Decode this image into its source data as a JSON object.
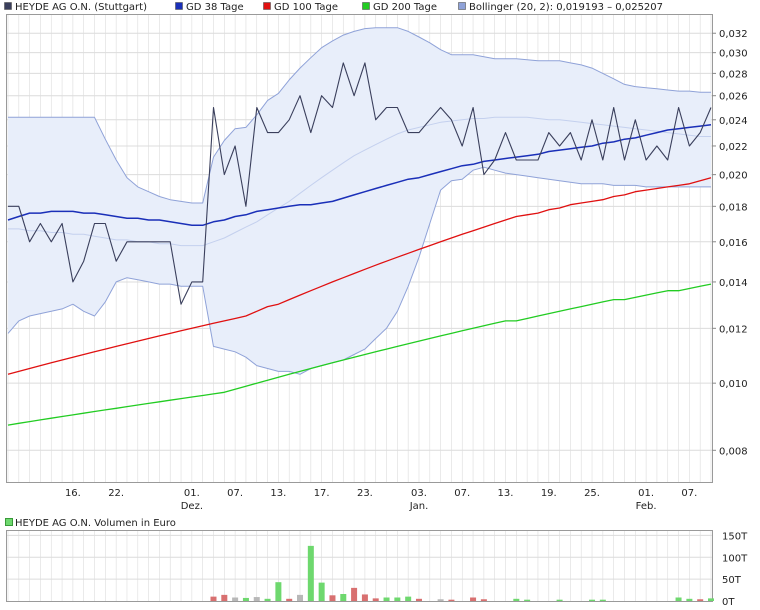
{
  "colors": {
    "price": "#3a3f5c",
    "gd38": "#1a2fb8",
    "gd100": "#e01010",
    "gd200": "#22cc22",
    "bollinger_fill": "#e8eefa",
    "bollinger_line": "#8fa2d8",
    "bollinger_mid": "#c4d0ee",
    "volume_up": "#6ed86e",
    "volume_down": "#d87070",
    "volume_flat": "#b8b8b8",
    "grid": "#dcdcdc"
  },
  "chart_data": [
    {
      "type": "line",
      "scale": "log",
      "legend": [
        {
          "label": "HEYDE AG O.N. (Stuttgart)",
          "color": "#3a3f5c"
        },
        {
          "label": "GD 38 Tage",
          "color": "#1a2fb8"
        },
        {
          "label": "GD 100 Tage",
          "color": "#e01010"
        },
        {
          "label": "GD 200 Tage",
          "color": "#22cc22"
        },
        {
          "label": "Bollinger (20, 2): 0,019193 – 0,025207",
          "color": "#8fa2d8"
        }
      ],
      "legend_placement": "top",
      "ylim": [
        0.0072,
        0.034
      ],
      "y_ticks": [
        {
          "value": 0.008,
          "label": "0,008"
        },
        {
          "value": 0.01,
          "label": "0,010"
        },
        {
          "value": 0.012,
          "label": "0,012"
        },
        {
          "value": 0.014,
          "label": "0,014"
        },
        {
          "value": 0.016,
          "label": "0,016"
        },
        {
          "value": 0.018,
          "label": "0,018"
        },
        {
          "value": 0.02,
          "label": "0,020"
        },
        {
          "value": 0.022,
          "label": "0,022"
        },
        {
          "value": 0.024,
          "label": "0,024"
        },
        {
          "value": 0.026,
          "label": "0,026"
        },
        {
          "value": 0.028,
          "label": "0,028"
        },
        {
          "value": 0.03,
          "label": "0,030"
        },
        {
          "value": 0.032,
          "label": "0,032"
        }
      ],
      "x_ticks": [
        {
          "i": 6,
          "label": "16.",
          "sub": ""
        },
        {
          "i": 10,
          "label": "22.",
          "sub": ""
        },
        {
          "i": 17,
          "label": "01.",
          "sub": "Dez."
        },
        {
          "i": 21,
          "label": "07.",
          "sub": ""
        },
        {
          "i": 25,
          "label": "13.",
          "sub": ""
        },
        {
          "i": 29,
          "label": "17.",
          "sub": ""
        },
        {
          "i": 33,
          "label": "23.",
          "sub": ""
        },
        {
          "i": 38,
          "label": "03.",
          "sub": "Jan."
        },
        {
          "i": 42,
          "label": "07.",
          "sub": ""
        },
        {
          "i": 46,
          "label": "13.",
          "sub": ""
        },
        {
          "i": 50,
          "label": "19.",
          "sub": ""
        },
        {
          "i": 54,
          "label": "25.",
          "sub": ""
        },
        {
          "i": 59,
          "label": "01.",
          "sub": "Feb."
        },
        {
          "i": 63,
          "label": "07.",
          "sub": ""
        }
      ],
      "n_points": 66,
      "grid": true,
      "series": [
        {
          "name": "HEYDE AG O.N. (Stuttgart)",
          "key": "price",
          "values": [
            0.018,
            0.018,
            0.016,
            0.017,
            0.016,
            0.017,
            0.014,
            0.015,
            0.017,
            0.017,
            0.015,
            0.016,
            0.016,
            0.016,
            0.016,
            0.016,
            0.013,
            0.014,
            0.014,
            0.025,
            0.02,
            0.022,
            0.018,
            0.025,
            0.023,
            0.023,
            0.024,
            0.026,
            0.023,
            0.026,
            0.025,
            0.029,
            0.026,
            0.029,
            0.024,
            0.025,
            0.025,
            0.023,
            0.023,
            0.024,
            0.025,
            0.024,
            0.022,
            0.025,
            0.02,
            0.021,
            0.023,
            0.021,
            0.021,
            0.021,
            0.023,
            0.022,
            0.023,
            0.021,
            0.024,
            0.021,
            0.025,
            0.021,
            0.024,
            0.021,
            0.022,
            0.021,
            0.025,
            0.022,
            0.023,
            0.025
          ]
        },
        {
          "name": "GD 38 Tage",
          "key": "gd38",
          "values": [
            0.0172,
            0.0174,
            0.0176,
            0.0176,
            0.0177,
            0.0177,
            0.0177,
            0.0176,
            0.0176,
            0.0175,
            0.0174,
            0.0173,
            0.0173,
            0.0172,
            0.0172,
            0.0171,
            0.017,
            0.0169,
            0.0169,
            0.0171,
            0.0172,
            0.0174,
            0.0175,
            0.0177,
            0.0178,
            0.0179,
            0.018,
            0.0181,
            0.0181,
            0.0182,
            0.0183,
            0.0185,
            0.0187,
            0.0189,
            0.0191,
            0.0193,
            0.0195,
            0.0197,
            0.0198,
            0.02,
            0.0202,
            0.0204,
            0.0206,
            0.0207,
            0.0209,
            0.021,
            0.0211,
            0.0212,
            0.0213,
            0.0214,
            0.0216,
            0.0217,
            0.0218,
            0.0219,
            0.022,
            0.0222,
            0.0223,
            0.0225,
            0.0226,
            0.0228,
            0.023,
            0.0232,
            0.0233,
            0.0234,
            0.0235,
            0.0236
          ]
        },
        {
          "name": "GD 100 Tage",
          "key": "gd100",
          "values": [
            0.0103,
            0.0104,
            0.0105,
            0.0106,
            0.0107,
            0.0108,
            0.0109,
            0.011,
            0.0111,
            0.0112,
            0.0113,
            0.0114,
            0.0115,
            0.0116,
            0.0117,
            0.0118,
            0.0119,
            0.012,
            0.0121,
            0.0122,
            0.0123,
            0.0124,
            0.0125,
            0.0127,
            0.0129,
            0.013,
            0.0132,
            0.0134,
            0.0136,
            0.0138,
            0.014,
            0.0142,
            0.0144,
            0.0146,
            0.0148,
            0.015,
            0.0152,
            0.0154,
            0.0156,
            0.0158,
            0.016,
            0.0162,
            0.0164,
            0.0166,
            0.0168,
            0.017,
            0.0172,
            0.0174,
            0.0175,
            0.0176,
            0.0178,
            0.0179,
            0.0181,
            0.0182,
            0.0183,
            0.0184,
            0.0186,
            0.0187,
            0.0189,
            0.019,
            0.0191,
            0.0192,
            0.0193,
            0.0194,
            0.0196,
            0.0198
          ]
        },
        {
          "name": "GD 200 Tage",
          "key": "gd200",
          "values": [
            0.0087,
            0.00875,
            0.0088,
            0.00885,
            0.0089,
            0.00895,
            0.009,
            0.00905,
            0.0091,
            0.00915,
            0.0092,
            0.00925,
            0.0093,
            0.00935,
            0.0094,
            0.00945,
            0.0095,
            0.00955,
            0.0096,
            0.00965,
            0.0097,
            0.0098,
            0.0099,
            0.01,
            0.0101,
            0.0102,
            0.0103,
            0.0104,
            0.0105,
            0.0106,
            0.0107,
            0.0108,
            0.0109,
            0.011,
            0.0111,
            0.0112,
            0.0113,
            0.0114,
            0.0115,
            0.0116,
            0.0117,
            0.0118,
            0.0119,
            0.012,
            0.0121,
            0.0122,
            0.0123,
            0.0123,
            0.0124,
            0.0125,
            0.0126,
            0.0127,
            0.0128,
            0.0129,
            0.013,
            0.0131,
            0.0132,
            0.0132,
            0.0133,
            0.0134,
            0.0135,
            0.0136,
            0.0136,
            0.0137,
            0.0138,
            0.0139
          ]
        },
        {
          "name": "Bollinger upper",
          "key": "boll_upper",
          "values": [
            0.0242,
            0.0242,
            0.0242,
            0.0242,
            0.0242,
            0.0242,
            0.0242,
            0.0242,
            0.0242,
            0.0225,
            0.021,
            0.0198,
            0.0192,
            0.0189,
            0.0186,
            0.0184,
            0.0183,
            0.0182,
            0.0182,
            0.0212,
            0.0224,
            0.0233,
            0.0234,
            0.0244,
            0.0256,
            0.0262,
            0.0274,
            0.0285,
            0.0295,
            0.0305,
            0.0312,
            0.0318,
            0.0322,
            0.0325,
            0.0326,
            0.0326,
            0.0326,
            0.0322,
            0.0316,
            0.031,
            0.0303,
            0.0298,
            0.0298,
            0.0298,
            0.0296,
            0.0294,
            0.0294,
            0.0294,
            0.0293,
            0.0292,
            0.0292,
            0.0292,
            0.029,
            0.0288,
            0.0285,
            0.028,
            0.0275,
            0.027,
            0.0268,
            0.0267,
            0.0266,
            0.0265,
            0.0264,
            0.0264,
            0.0263,
            0.0263
          ]
        },
        {
          "name": "Bollinger middle",
          "key": "boll_mid",
          "values": [
            0.0167,
            0.0167,
            0.0166,
            0.0166,
            0.0165,
            0.0165,
            0.0164,
            0.0164,
            0.0163,
            0.0162,
            0.0161,
            0.0161,
            0.016,
            0.016,
            0.0159,
            0.0159,
            0.0158,
            0.0158,
            0.0158,
            0.016,
            0.0162,
            0.0165,
            0.0168,
            0.0171,
            0.0175,
            0.0179,
            0.0183,
            0.0188,
            0.0193,
            0.0198,
            0.0203,
            0.0208,
            0.0213,
            0.0217,
            0.0221,
            0.0225,
            0.0229,
            0.0232,
            0.0234,
            0.0236,
            0.0238,
            0.0239,
            0.024,
            0.0241,
            0.0241,
            0.0242,
            0.0242,
            0.0242,
            0.0242,
            0.0241,
            0.024,
            0.024,
            0.0239,
            0.0238,
            0.0237,
            0.0236,
            0.0235,
            0.0234,
            0.0233,
            0.0232,
            0.0231,
            0.023,
            0.0229,
            0.0228,
            0.0227,
            0.0227
          ]
        },
        {
          "name": "Bollinger lower",
          "key": "boll_lower",
          "values": [
            0.0118,
            0.0123,
            0.0125,
            0.0126,
            0.0127,
            0.0128,
            0.013,
            0.0127,
            0.0125,
            0.0131,
            0.014,
            0.0142,
            0.0141,
            0.014,
            0.0139,
            0.0139,
            0.0138,
            0.0138,
            0.0138,
            0.0113,
            0.0112,
            0.0111,
            0.0109,
            0.0106,
            0.0105,
            0.0104,
            0.0104,
            0.0103,
            0.0105,
            0.0106,
            0.0107,
            0.0108,
            0.011,
            0.0112,
            0.0116,
            0.012,
            0.0127,
            0.0138,
            0.0152,
            0.017,
            0.019,
            0.0196,
            0.0197,
            0.0203,
            0.0205,
            0.0203,
            0.0201,
            0.02,
            0.0199,
            0.0198,
            0.0197,
            0.0196,
            0.0195,
            0.0194,
            0.0194,
            0.0194,
            0.0193,
            0.0193,
            0.0193,
            0.0192,
            0.0192,
            0.0192,
            0.0192,
            0.0192,
            0.0192,
            0.0192
          ]
        }
      ]
    },
    {
      "type": "bar",
      "title": "HEYDE AG O.N. Volumen in Euro",
      "ylim": [
        0,
        160
      ],
      "y_ticks": [
        {
          "value": 0,
          "label": "0T"
        },
        {
          "value": 50,
          "label": "50T"
        },
        {
          "value": 100,
          "label": "100T"
        },
        {
          "value": 150,
          "label": "150T"
        }
      ],
      "unit": "T",
      "series": [
        {
          "name": "Volumen",
          "values": [
            0,
            0,
            0,
            0,
            0,
            0,
            0,
            0,
            0,
            0,
            0,
            0,
            0,
            0,
            0,
            0,
            0,
            0,
            0,
            10,
            14,
            8,
            7,
            9,
            5,
            43,
            5,
            14,
            126,
            42,
            13,
            16,
            30,
            15,
            6,
            8,
            8,
            10,
            5,
            0,
            4,
            3,
            0,
            8,
            4,
            0,
            0,
            5,
            3,
            0,
            0,
            3,
            0,
            0,
            3,
            3,
            0,
            0,
            0,
            0,
            0,
            0,
            8,
            5,
            4,
            6
          ],
          "direction": [
            "n",
            "n",
            "n",
            "n",
            "n",
            "n",
            "n",
            "n",
            "n",
            "n",
            "n",
            "n",
            "n",
            "n",
            "n",
            "n",
            "n",
            "n",
            "n",
            "d",
            "d",
            "f",
            "u",
            "f",
            "u",
            "u",
            "d",
            "f",
            "u",
            "u",
            "d",
            "u",
            "d",
            "d",
            "d",
            "u",
            "u",
            "u",
            "d",
            "n",
            "f",
            "d",
            "n",
            "d",
            "d",
            "n",
            "n",
            "u",
            "u",
            "n",
            "n",
            "u",
            "n",
            "n",
            "u",
            "u",
            "n",
            "n",
            "n",
            "n",
            "n",
            "n",
            "u",
            "u",
            "d",
            "u"
          ]
        }
      ]
    }
  ]
}
